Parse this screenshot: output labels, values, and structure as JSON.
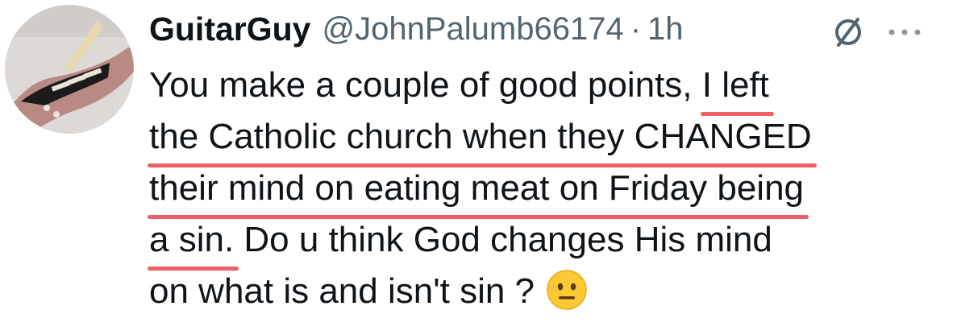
{
  "author": {
    "display_name": "GuitarGuy",
    "handle": "@JohnPalumb66174",
    "separator": "·",
    "time": "1h"
  },
  "icons": {
    "avatar": "guitar-photo",
    "grok": "grok-slash-icon",
    "more": "more-horizontal-icon"
  },
  "tweet": {
    "line1_plain": "You make a couple of good points, ",
    "line1_highlight": "I left",
    "line2_highlight": "the Catholic church when they CHANGED",
    "line3_highlight": "their mind on eating meat on Friday being",
    "line4_highlight": "a sin.",
    "line4_plain": " Do u think God changes His mind",
    "line5_plain": "on what is and isn't sin ?",
    "emoji": "neutral-face",
    "highlight_color": "#ef5f66"
  },
  "colors": {
    "text": "#0f1419",
    "secondary": "#536471"
  }
}
